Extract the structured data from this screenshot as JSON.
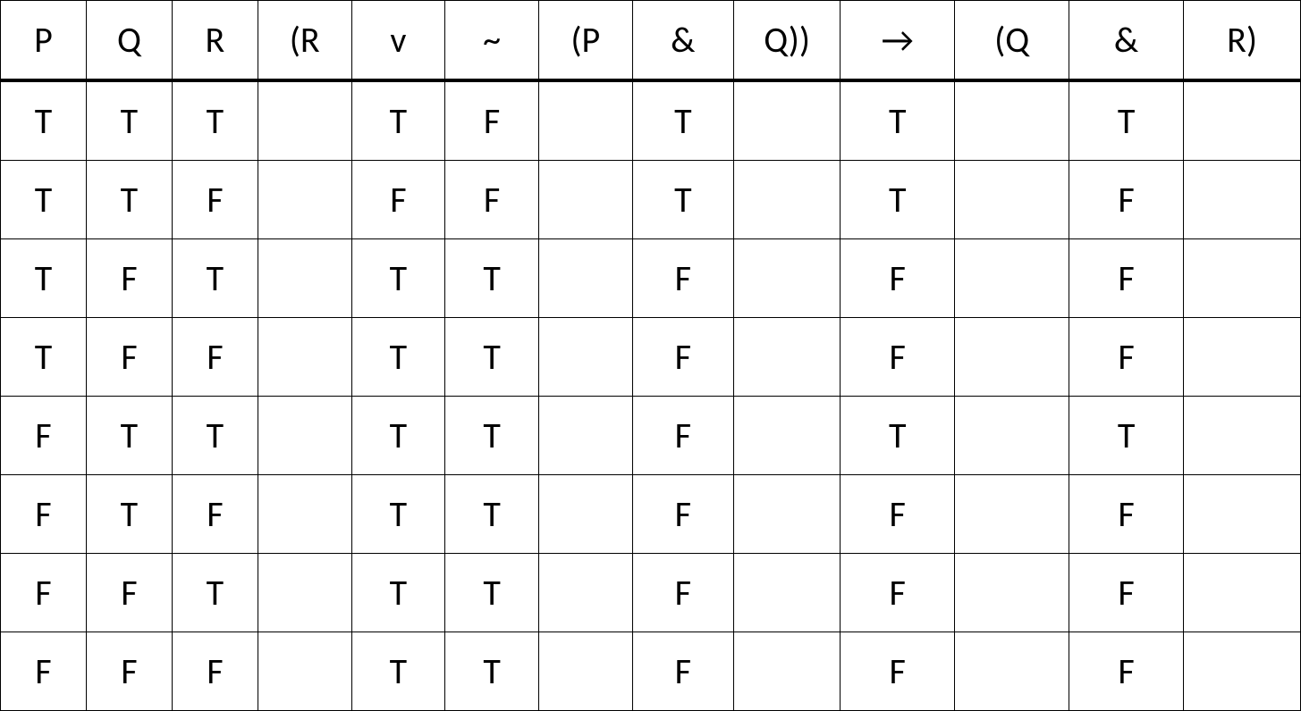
{
  "headers": [
    "P",
    "Q",
    "R",
    "(R",
    "v",
    "~",
    "(P",
    "&",
    "Q))",
    "→",
    "(Q",
    "&",
    "R)"
  ],
  "rows": [
    [
      "T",
      "T",
      "T",
      "",
      "T",
      "F",
      "",
      "T",
      "",
      "T",
      "",
      "T",
      ""
    ],
    [
      "T",
      "T",
      "F",
      "",
      "F",
      "F",
      "",
      "T",
      "",
      "T",
      "",
      "F",
      ""
    ],
    [
      "T",
      "F",
      "T",
      "",
      "T",
      "T",
      "",
      "F",
      "",
      "F",
      "",
      "F",
      ""
    ],
    [
      "T",
      "F",
      "F",
      "",
      "T",
      "T",
      "",
      "F",
      "",
      "F",
      "",
      "F",
      ""
    ],
    [
      "F",
      "T",
      "T",
      "",
      "T",
      "T",
      "",
      "F",
      "",
      "T",
      "",
      "T",
      ""
    ],
    [
      "F",
      "T",
      "F",
      "",
      "T",
      "T",
      "",
      "F",
      "",
      "F",
      "",
      "F",
      ""
    ],
    [
      "F",
      "F",
      "T",
      "",
      "T",
      "T",
      "",
      "F",
      "",
      "F",
      "",
      "F",
      ""
    ],
    [
      "F",
      "F",
      "F",
      "",
      "T",
      "T",
      "",
      "F",
      "",
      "F",
      "",
      "F",
      ""
    ]
  ]
}
